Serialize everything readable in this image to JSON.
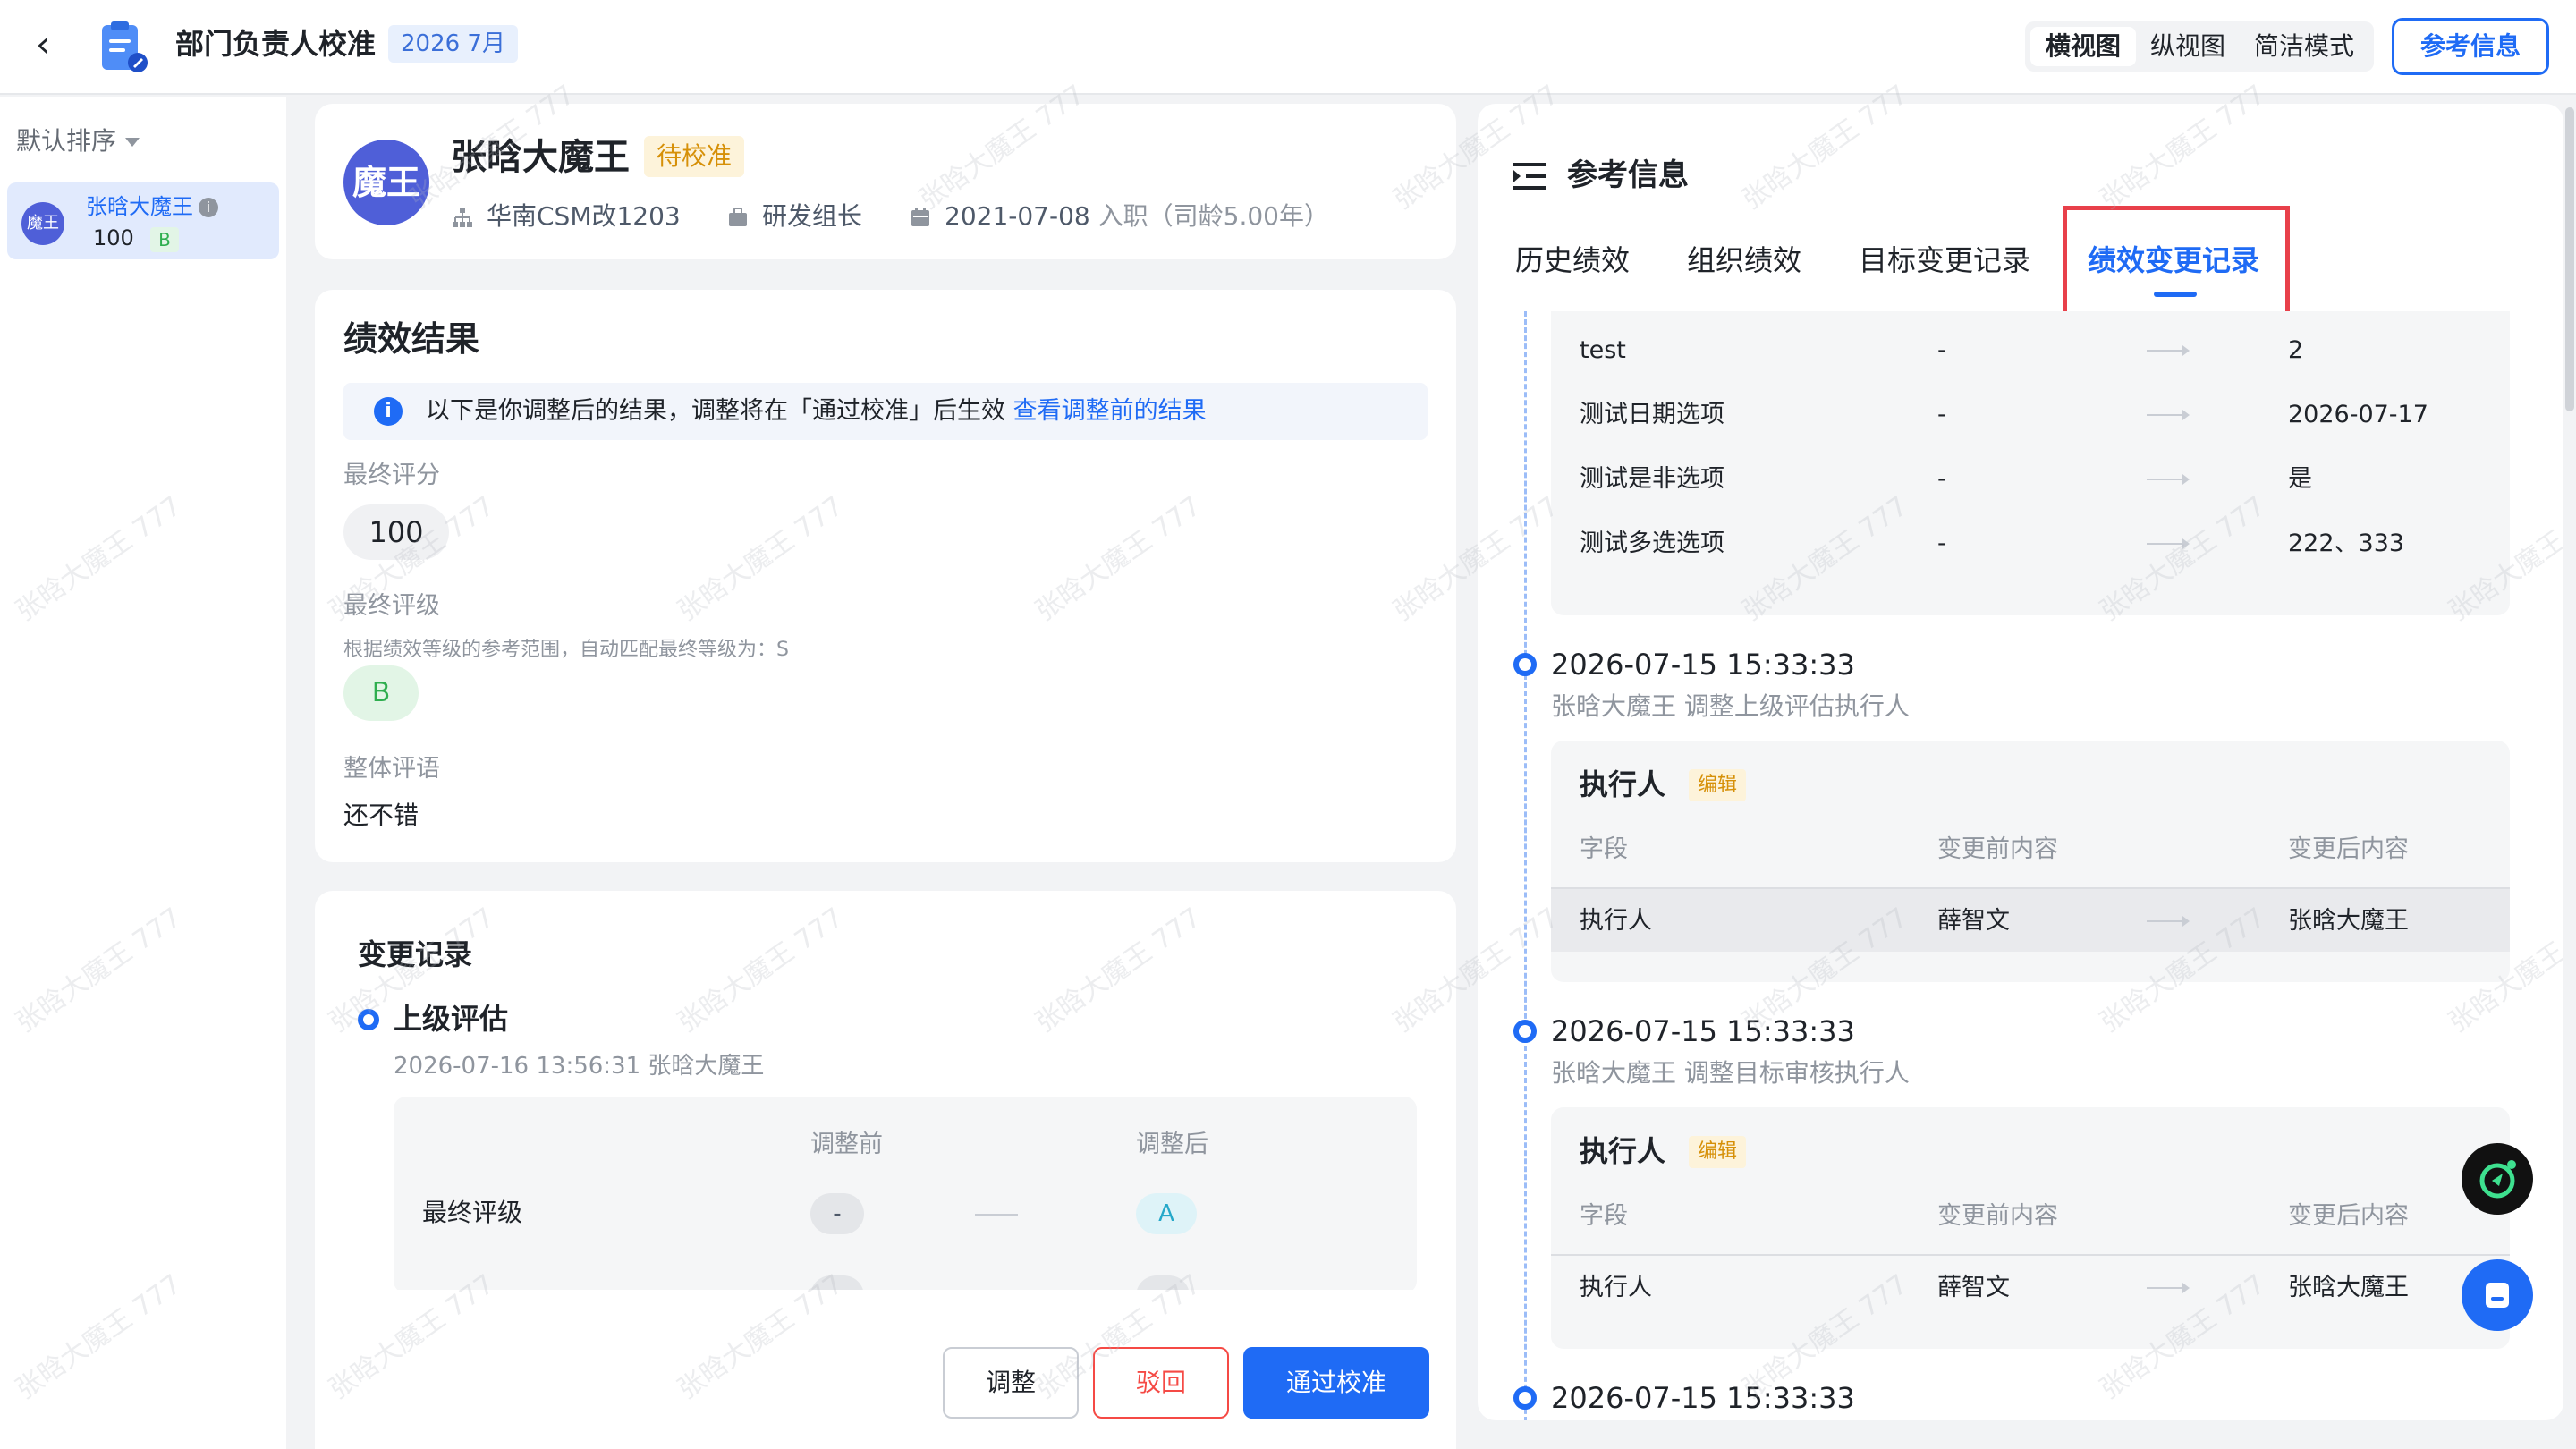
{
  "header": {
    "title": "部门负责人校准",
    "period": "2026 7月",
    "views": [
      "横视图",
      "纵视图",
      "简洁模式"
    ],
    "active_view": "横视图",
    "ref_button": "参考信息"
  },
  "sidebar": {
    "sort_label": "默认排序",
    "employee": {
      "avatar": "魔王",
      "name": "张晗大魔王",
      "score": "100",
      "grade": "B"
    }
  },
  "profile": {
    "avatar": "魔王",
    "name": "张晗大魔王",
    "status": "待校准",
    "department": "华南CSM改1203",
    "position": "研发组长",
    "join_date": "2021-07-08",
    "join_label": "入职",
    "tenure": "（司龄5.00年）"
  },
  "result": {
    "title": "绩效结果",
    "notice": "以下是你调整后的结果，调整将在「通过校准」后生效",
    "notice_link": "查看调整前的结果",
    "final_score_label": "最终评分",
    "final_score": "100",
    "final_grade_label": "最终评级",
    "grade_hint": "根据绩效等级的参考范围，自动匹配最终等级为：S",
    "final_grade": "B",
    "comment_label": "整体评语",
    "comment": "还不错"
  },
  "change_record": {
    "title": "变更记录",
    "item_title": "上级评估",
    "item_meta": "2026-07-16 13:56:31 张晗大魔王",
    "col_before": "调整前",
    "col_after": "调整后",
    "row_label": "最终评级",
    "before": "-",
    "after": "A"
  },
  "actions": {
    "adjust": "调整",
    "reject": "驳回",
    "pass": "通过校准"
  },
  "reference": {
    "title": "参考信息",
    "tabs": [
      "历史绩效",
      "组织绩效",
      "目标变更记录",
      "绩效变更记录"
    ],
    "active_tab": "绩效变更记录",
    "top_rows": [
      {
        "field": "test",
        "before": "-",
        "after": "2"
      },
      {
        "field": "测试日期选项",
        "before": "-",
        "after": "2026-07-17"
      },
      {
        "field": "测试是非选项",
        "before": "-",
        "after": "是"
      },
      {
        "field": "测试多选选项",
        "before": "-",
        "after": "222、333"
      }
    ],
    "entries": [
      {
        "time": "2026-07-15 15:33:33",
        "desc": "张晗大魔王 调整上级评估执行人",
        "block_title": "执行人",
        "tag": "编辑",
        "headers": [
          "字段",
          "变更前内容",
          "变更后内容"
        ],
        "row": {
          "field": "执行人",
          "before": "薛智文",
          "after": "张晗大魔王"
        }
      },
      {
        "time": "2026-07-15 15:33:33",
        "desc": "张晗大魔王 调整目标审核执行人",
        "block_title": "执行人",
        "tag": "编辑",
        "headers": [
          "字段",
          "变更前内容",
          "变更后内容"
        ],
        "row": {
          "field": "执行人",
          "before": "薛智文",
          "after": "张晗大魔王"
        }
      },
      {
        "time": "2026-07-15 15:33:33"
      }
    ]
  },
  "watermark": "张晗大魔王 777",
  "colors": {
    "primary": "#1f6bf5",
    "danger": "#f54a45",
    "warning": "#d69008",
    "success": "#2fae4f"
  }
}
